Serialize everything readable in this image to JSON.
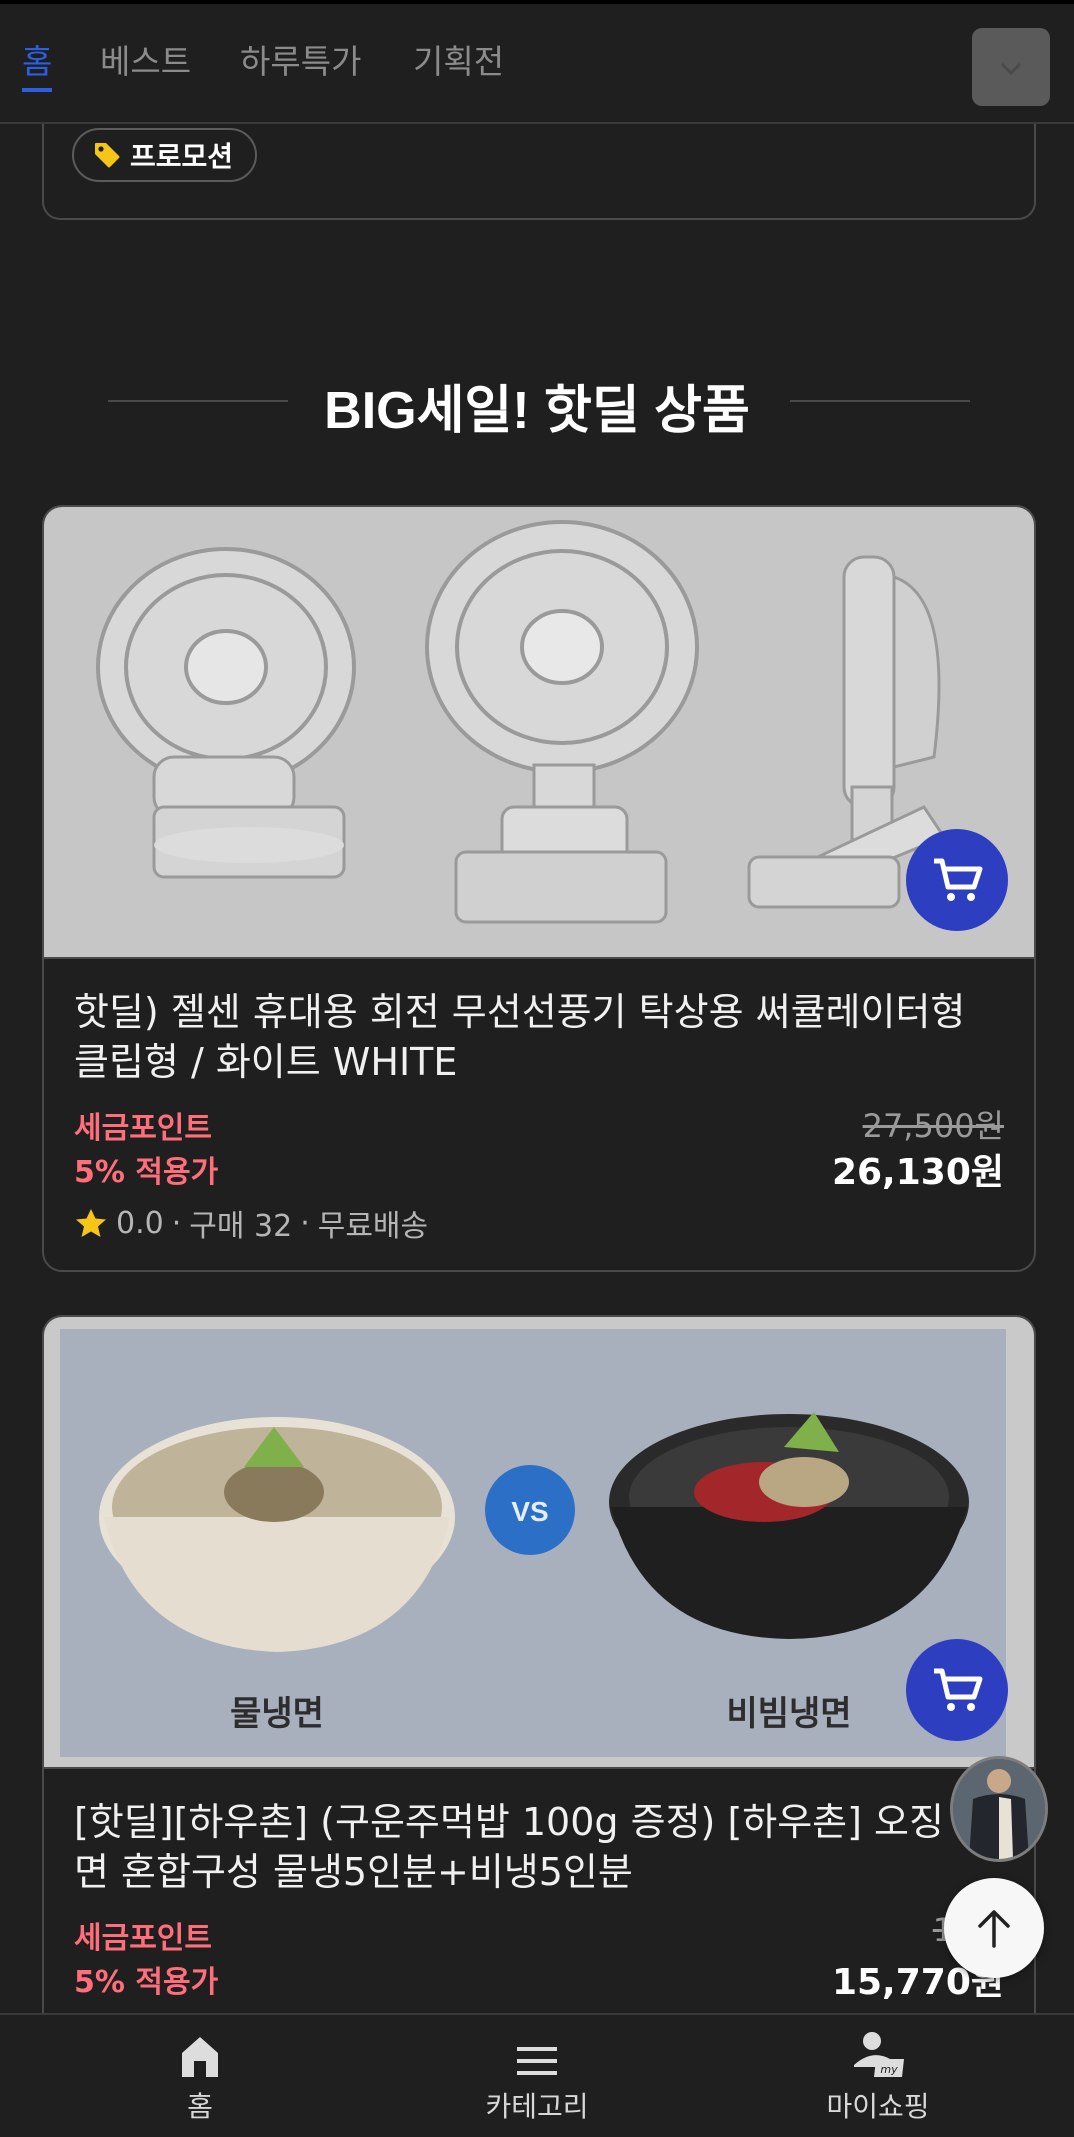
{
  "top_nav": {
    "tabs": [
      {
        "label": "홈",
        "active": true
      },
      {
        "label": "베스트",
        "active": false
      },
      {
        "label": "하루특가",
        "active": false
      },
      {
        "label": "기획전",
        "active": false
      }
    ]
  },
  "promotion": {
    "tag_label": "프로모션"
  },
  "section": {
    "title": "BIG세일! 핫딜 상품"
  },
  "products": [
    {
      "name": "핫딜) 젤센 휴대용 회전 무선선풍기 탁상용 써큘레이터형 클립형 / 화이트 WHITE",
      "point_line1": "세금포인트",
      "point_line2": "5% 적용가",
      "original_price": "27,500원",
      "sale_price": "26,130원",
      "rating": "0.0",
      "purchase": "구매 32",
      "shipping": "무료배송",
      "rating_icon": "star-icon"
    },
    {
      "name": "[핫딜][하우촌] (구운주먹밥 100g 증정) [하우촌] 오징 냉면 혼합구성 물냉5인분+비냉5인분",
      "point_line1": "세금포인트",
      "point_line2": "5% 적용가",
      "original_price": "16,6",
      "sale_price": "15,770원",
      "image_labels": {
        "left": "물냉면",
        "vs": "VS",
        "right": "비빔냉면"
      }
    }
  ],
  "bottom_nav": {
    "items": [
      {
        "label": "홈",
        "icon": "home-icon"
      },
      {
        "label": "카테고리",
        "icon": "menu-icon"
      },
      {
        "label": "마이쇼핑",
        "icon": "my-shopping-icon"
      }
    ]
  },
  "colors": {
    "background": "#1f1f1f",
    "accent_blue": "#2d5fe0",
    "cart_button": "#2d3fc0",
    "point_pink": "#ff6e7a",
    "star_yellow": "#f5c518"
  }
}
